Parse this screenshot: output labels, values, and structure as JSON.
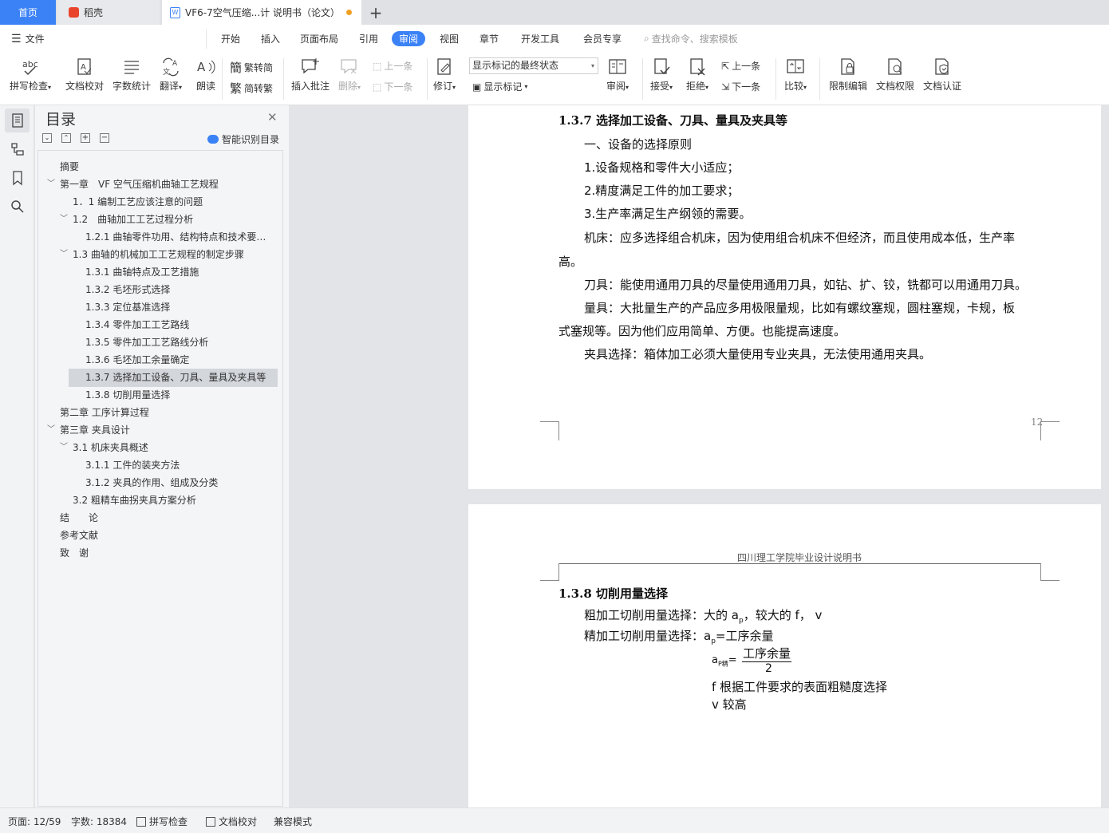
{
  "tabs": {
    "home": "首页",
    "daoke": "稻壳",
    "doc": "VF6-7空气压缩...计 说明书（论文）"
  },
  "menu": {
    "file": "文件",
    "items": [
      "开始",
      "插入",
      "页面布局",
      "引用",
      "审阅",
      "视图",
      "章节",
      "开发工具",
      "会员专享"
    ],
    "active": "审阅",
    "search": "查找命令、搜索模板"
  },
  "ribbon": {
    "spell": "拼写检查",
    "proof": "文档校对",
    "wordcount": "字数统计",
    "translate": "翻译",
    "read": "朗读",
    "trad": "繁转简",
    "simp": "简转繁",
    "insert_comment": "插入批注",
    "delete": "删除",
    "prev_comment": "上一条",
    "next_comment": "下一条",
    "revise": "修订",
    "markup_state": "显示标记的最终状态",
    "show_markup": "显示标记",
    "review": "审阅",
    "accept": "接受",
    "reject": "拒绝",
    "prev_change": "上一条",
    "next_change": "下一条",
    "compare": "比较",
    "restrict": "限制编辑",
    "permission": "文档权限",
    "certify": "文档认证"
  },
  "toc": {
    "title": "目录",
    "smart": "智能识别目录",
    "items": [
      {
        "text": "摘要",
        "level": 0
      },
      {
        "text": "第一章　VF 空气压缩机曲轴工艺规程",
        "level": 0,
        "arrow": true
      },
      {
        "text": "1．1  编制工艺应该注意的问题",
        "level": 1
      },
      {
        "text": "1.2　曲轴加工工艺过程分析",
        "level": 1,
        "arrow": true
      },
      {
        "text": "1.2.1  曲轴零件功用、结构特点和技术要求分析",
        "level": 2
      },
      {
        "text": "1.3  曲轴的机械加工工艺规程的制定步骤",
        "level": 1,
        "arrow": true
      },
      {
        "text": "1.3.1 曲轴特点及工艺措施",
        "level": 2
      },
      {
        "text": "1.3.2  毛坯形式选择",
        "level": 2
      },
      {
        "text": "1.3.3  定位基准选择",
        "level": 2
      },
      {
        "text": "1.3.4  零件加工工艺路线",
        "level": 2
      },
      {
        "text": "1.3.5  零件加工工艺路线分析",
        "level": 2
      },
      {
        "text": "1.3.6  毛坯加工余量确定",
        "level": 2
      },
      {
        "text": "1.3.7  选择加工设备、刀具、量具及夹具等",
        "level": 2,
        "selected": true
      },
      {
        "text": "1.3.8  切削用量选择",
        "level": 2
      },
      {
        "text": "第二章  工序计算过程",
        "level": 0
      },
      {
        "text": "第三章  夹具设计",
        "level": 0,
        "arrow": true
      },
      {
        "text": "3.1  机床夹具概述",
        "level": 1,
        "arrow": true
      },
      {
        "text": "3.1.1  工件的装夹方法",
        "level": 2
      },
      {
        "text": "3.1.2  夹具的作用、组成及分类",
        "level": 2
      },
      {
        "text": "3.2  粗精车曲拐夹具方案分析",
        "level": 1
      },
      {
        "text": "结　　论",
        "level": 0
      },
      {
        "text": "参考文献",
        "level": 0
      },
      {
        "text": "致　谢",
        "level": 0
      }
    ]
  },
  "page1": {
    "heading": "1.3.7  选择加工设备、刀具、量具及夹具等",
    "lines": [
      "一、设备的选择原则",
      "1.设备规格和零件大小适应；",
      "2.精度满足工件的加工要求；",
      "3.生产率满足生产纲领的需要。",
      "机床：应多选择组合机床，因为使用组合机床不但经济，而且使用成本低，生产率",
      "高。",
      "刀具：能使用通用刀具的尽量使用通用刀具，如钻、扩、铰，铣都可以用通用刀具。",
      "量具：大批量生产的产品应多用极限量规，比如有螺纹塞规，圆柱塞规，卡规，板",
      "式塞规等。因为他们应用简单、方便。也能提高速度。",
      "夹具选择：箱体加工必须大量使用专业夹具，无法使用通用夹具。"
    ],
    "page_number": "12"
  },
  "page2": {
    "header": "四川理工学院毕业设计说明书",
    "heading": "1.3.8  切削用量选择",
    "rough": "粗加工切削用量选择：大的 a",
    "rough_sub": "p",
    "rough_tail": "，较大的 f，   v",
    "fine": "精加工切削用量选择：a",
    "fine_sub": "p",
    "fine_tail": "=工序余量",
    "formula_lhs": "a",
    "formula_sub": "P精",
    "formula_num": "工序余量",
    "formula_den": "2",
    "f_line": "f  根据工件要求的表面粗糙度选择",
    "v_line": "v  较高"
  },
  "status": {
    "page": "页面: 12/59",
    "words": "字数: 18384",
    "spell": "拼写检查",
    "proof": "文档校对",
    "compat": "兼容模式"
  },
  "colors": {
    "accent": "#3b82f6",
    "selected_row": "#d3d6db"
  }
}
